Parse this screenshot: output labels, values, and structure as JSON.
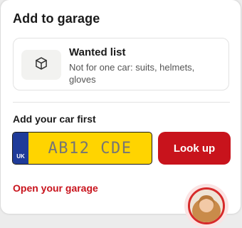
{
  "panel": {
    "title": "Add to garage"
  },
  "wanted_list": {
    "icon": "box-icon",
    "title": "Wanted list",
    "description": "Not for one car: suits, helmets, gloves"
  },
  "add_car": {
    "label": "Add your car first",
    "plate_country": "UK",
    "plate_placeholder": "AB12 CDE",
    "lookup_label": "Look up"
  },
  "footer": {
    "open_garage_label": "Open your garage"
  },
  "colors": {
    "accent": "#c8131c",
    "plate_yellow": "#ffd400",
    "plate_band": "#1f3b99"
  }
}
